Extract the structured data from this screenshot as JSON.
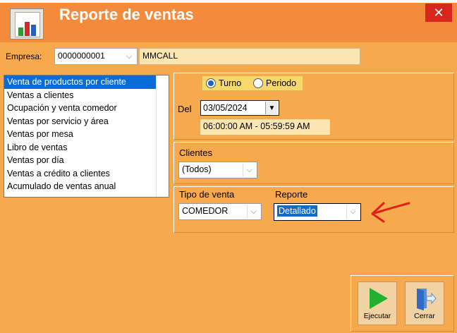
{
  "window": {
    "title": "Reporte de ventas",
    "close_label": "✕"
  },
  "empresa": {
    "label": "Empresa:",
    "code": "0000000001",
    "name": "MMCALL"
  },
  "report_list": {
    "items": [
      "Venta de productos por cliente",
      "Ventas a clientes",
      "Ocupación y venta comedor",
      "Ventas por servicio y área",
      "Ventas por mesa",
      "Libro de ventas",
      "Ventas por día",
      "Ventas a crédito a clientes",
      "Acumulado de ventas anual"
    ],
    "selected_index": 0
  },
  "period": {
    "radio_turno": "Turno",
    "radio_periodo": "Periodo",
    "selected": "Turno",
    "del_label": "Del",
    "date_value": "03/05/2024",
    "hour_range": "06:00:00 AM - 05:59:59 AM"
  },
  "clientes": {
    "label": "Clientes",
    "value": "(Todos)"
  },
  "tipo_venta": {
    "label": "Tipo de venta",
    "value": "COMEDOR"
  },
  "reporte": {
    "label": "Reporte",
    "value": "Detallado"
  },
  "buttons": {
    "ejecutar": "Ejecutar",
    "cerrar": "Cerrar"
  },
  "colors": {
    "titlebar": "#f38a3c",
    "body": "#f7a94e",
    "selection": "#0a6bd6",
    "annotation": "#e0201a"
  }
}
